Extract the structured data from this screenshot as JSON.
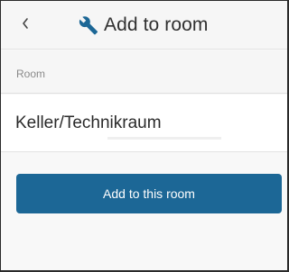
{
  "header": {
    "back_icon": "chevron-left-icon",
    "title_icon": "wrench-icon",
    "title": "Add to room"
  },
  "section": {
    "label": "Room"
  },
  "room": {
    "name": "Keller/Technikraum"
  },
  "actions": {
    "add_label": "Add to this room"
  },
  "colors": {
    "accent": "#1c6796",
    "background": "#f8f8f8",
    "title_text": "#303030",
    "label_text": "#8a8a8a"
  }
}
